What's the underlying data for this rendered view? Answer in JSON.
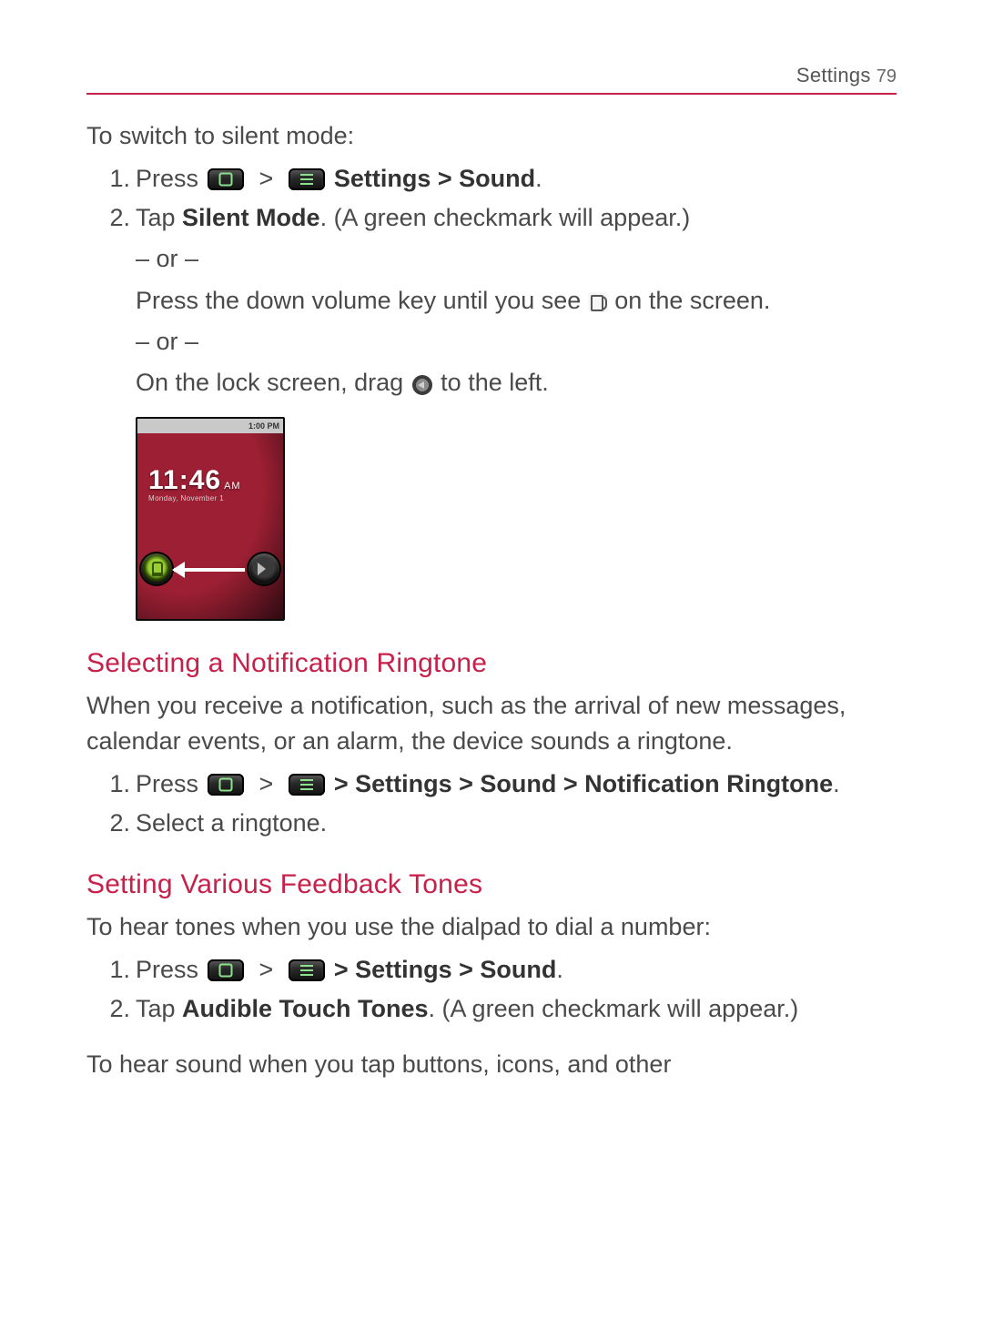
{
  "header": {
    "section": "Settings",
    "page_no": "79"
  },
  "silent": {
    "lead": "To switch to silent mode:",
    "step1_num": "1.",
    "step1_press": "Press ",
    "step1_path": " Settings > Sound",
    "step1_tail": ".",
    "step2_num": "2.",
    "step2_a": "Tap ",
    "step2_b": "Silent Mode",
    "step2_c": ". (A green checkmark will appear.)",
    "or": "– or –",
    "alt1_a": "Press the down volume key until you see ",
    "alt1_b": " on the screen.",
    "alt2_a": "On the lock screen, drag ",
    "alt2_b": " to the left."
  },
  "lock_thumb": {
    "status_time": "1:00 PM",
    "clock": "11:46",
    "ampm": "AM",
    "date": "Monday, November 1"
  },
  "notif": {
    "heading": "Selecting a Notification Ringtone",
    "para": "When you receive a notification, such as the arrival of new messages, calendar events, or an alarm, the device sounds a ringtone.",
    "step1_num": "1.",
    "step1_press": "Press ",
    "step1_path": " > Settings > Sound > Notification Ringtone",
    "step1_tail": ".",
    "step2_num": "2.",
    "step2": "Select a ringtone."
  },
  "feedback": {
    "heading": "Setting Various Feedback Tones",
    "lead": "To hear tones when you use the dialpad to dial a number:",
    "step1_num": "1.",
    "step1_press": "Press ",
    "step1_path": " > Settings > Sound",
    "step1_tail": ".",
    "step2_num": "2.",
    "step2_a": "Tap ",
    "step2_b": "Audible Touch Tones",
    "step2_c": ". (A green checkmark will appear.)",
    "trail": "To hear sound when you tap buttons, icons, and other"
  }
}
